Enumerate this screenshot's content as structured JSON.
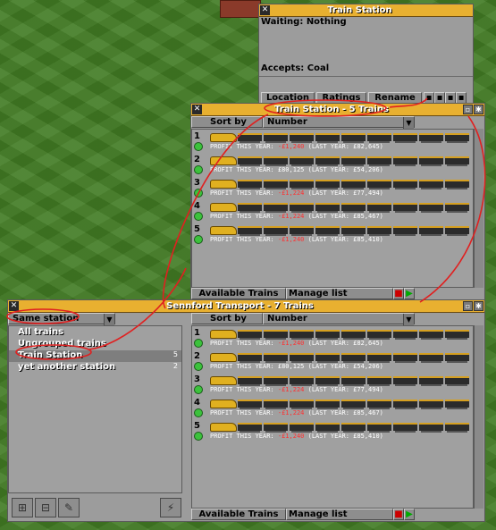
{
  "station_window": {
    "title": "Train Station",
    "waiting": "Waiting: Nothing",
    "accepts": "Accepts: Coal",
    "buttons": [
      "Location",
      "Ratings",
      "Rename"
    ]
  },
  "station_trains_window": {
    "title": "Train Station - 5 Trains",
    "sort_by_label": "Sort by",
    "sort_value": "Number",
    "bottom_buttons": {
      "available": "Available Trains",
      "manage": "Manage list"
    },
    "trains": [
      {
        "num": "1",
        "profit_label": "PROFIT THIS YEAR:",
        "profit": "-£1,240",
        "last": "(LAST YEAR: £82,645)"
      },
      {
        "num": "2",
        "profit_label": "PROFIT THIS YEAR:",
        "profit": "£80,125",
        "last": "(LAST YEAR: £54,206)"
      },
      {
        "num": "3",
        "profit_label": "PROFIT THIS YEAR:",
        "profit": "-£1,224",
        "last": "(LAST YEAR: £77,494)"
      },
      {
        "num": "4",
        "profit_label": "PROFIT THIS YEAR:",
        "profit": "-£1,224",
        "last": "(LAST YEAR: £85,467)"
      },
      {
        "num": "5",
        "profit_label": "PROFIT THIS YEAR:",
        "profit": "-£1,240",
        "last": "(LAST YEAR: £85,410)"
      }
    ]
  },
  "company_window": {
    "title": "Sennford Transport - 7 Trains",
    "group_by": "Same station",
    "groups": [
      {
        "label": "All trains",
        "count": ""
      },
      {
        "label": "Ungrouped trains",
        "count": ""
      },
      {
        "label": "Train Station",
        "count": "5"
      },
      {
        "label": "yet another station",
        "count": "2"
      }
    ],
    "sort_by_label": "Sort by",
    "sort_value": "Number",
    "bottom_buttons": {
      "available": "Available Trains",
      "manage": "Manage list"
    },
    "trains": [
      {
        "num": "1",
        "profit_label": "PROFIT THIS YEAR:",
        "profit": "-£1,240",
        "last": "(LAST YEAR: £82,645)"
      },
      {
        "num": "2",
        "profit_label": "PROFIT THIS YEAR:",
        "profit": "£80,125",
        "last": "(LAST YEAR: £54,206)"
      },
      {
        "num": "3",
        "profit_label": "PROFIT THIS YEAR:",
        "profit": "-£1,224",
        "last": "(LAST YEAR: £77,494)"
      },
      {
        "num": "4",
        "profit_label": "PROFIT THIS YEAR:",
        "profit": "-£1,224",
        "last": "(LAST YEAR: £85,467)"
      },
      {
        "num": "5",
        "profit_label": "PROFIT THIS YEAR:",
        "profit": "-£1,240",
        "last": "(LAST YEAR: £85,410)"
      }
    ]
  },
  "colors": {
    "titlebar": "#e8b030",
    "window": "#9c9c9c",
    "grass": "#427c24",
    "annotation": "#e02020",
    "status_ok": "#3cc23c"
  }
}
